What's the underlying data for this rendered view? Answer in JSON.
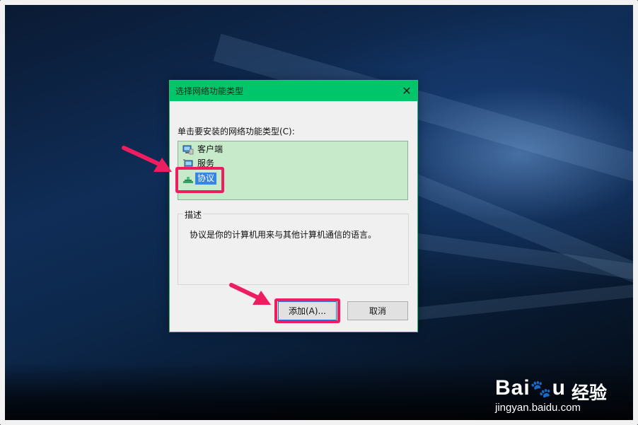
{
  "dialog": {
    "title": "选择网络功能类型",
    "close_icon": "close-icon",
    "prompt": "单击要安装的网络功能类型(C):",
    "items": [
      {
        "label": "客户端",
        "icon": "client-icon"
      },
      {
        "label": "服务",
        "icon": "service-icon"
      },
      {
        "label": "协议",
        "icon": "protocol-icon",
        "selected": true
      }
    ],
    "description_legend": "描述",
    "description_text": "协议是你的计算机用来与其他计算机通信的语言。",
    "add_button": "添加(A)...",
    "cancel_button": "取消"
  },
  "watermark": {
    "logo_text": "Bai",
    "logo_tail": "u",
    "brand_cn": "经验",
    "url": "jingyan.baidu.com"
  },
  "colors": {
    "titlebar": "#00c56a",
    "listbox": "#c7eacb",
    "selection": "#3486e2",
    "highlight": "#ee1d5f"
  }
}
